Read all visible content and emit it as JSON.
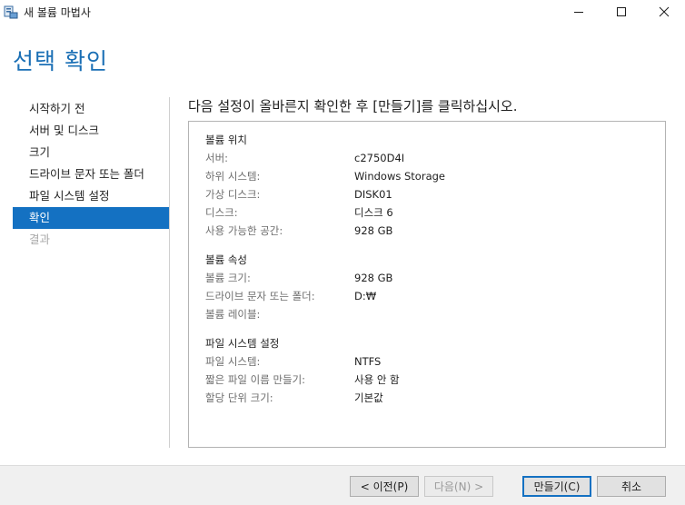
{
  "window": {
    "title": "새 볼륨 마법사",
    "icon": "volume-wizard-icon"
  },
  "heading": "선택 확인",
  "nav": {
    "items": [
      {
        "label": "시작하기 전",
        "state": "normal"
      },
      {
        "label": "서버 및 디스크",
        "state": "normal"
      },
      {
        "label": "크기",
        "state": "normal"
      },
      {
        "label": "드라이브 문자 또는 폴더",
        "state": "normal"
      },
      {
        "label": "파일 시스템 설정",
        "state": "normal"
      },
      {
        "label": "확인",
        "state": "active"
      },
      {
        "label": "결과",
        "state": "disabled"
      }
    ]
  },
  "instruction": "다음 설정이 올바른지 확인한 후 [만들기]를 클릭하십시오.",
  "summary": {
    "location": {
      "title": "볼륨 위치",
      "rows": [
        {
          "key": "서버:",
          "value": "c2750D4I"
        },
        {
          "key": "하위 시스템:",
          "value": "Windows Storage"
        },
        {
          "key": "가상 디스크:",
          "value": "DISK01"
        },
        {
          "key": "디스크:",
          "value": "디스크 6"
        },
        {
          "key": "사용 가능한 공간:",
          "value": "928 GB"
        }
      ]
    },
    "properties": {
      "title": "볼륨 속성",
      "rows": [
        {
          "key": "볼륨 크기:",
          "value": "928 GB"
        },
        {
          "key": "드라이브 문자 또는 폴더:",
          "value": "D:₩"
        },
        {
          "key": "볼륨 레이블:",
          "value": ""
        }
      ]
    },
    "filesystem": {
      "title": "파일 시스템 설정",
      "rows": [
        {
          "key": "파일 시스템:",
          "value": "NTFS"
        },
        {
          "key": "짧은 파일 이름 만들기:",
          "value": "사용 안 함"
        },
        {
          "key": "할당 단위 크기:",
          "value": "기본값"
        }
      ]
    }
  },
  "buttons": {
    "previous": "< 이전(P)",
    "next": "다음(N) >",
    "create": "만들기(C)",
    "cancel": "취소"
  },
  "colors": {
    "accent": "#1471c2",
    "heading": "#1a6fb5"
  }
}
